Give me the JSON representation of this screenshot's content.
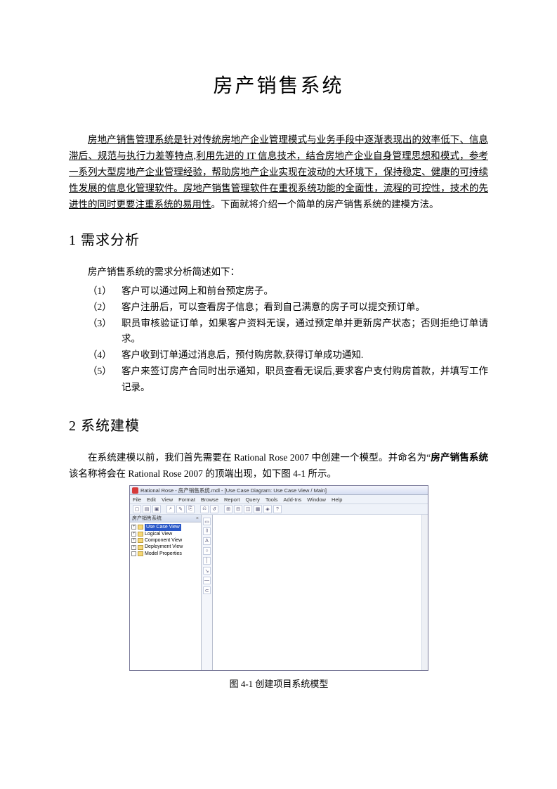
{
  "title": "房产销售系统",
  "intro_underlined": "房地产销售管理系统是针对传统房地产企业管理模式与业务手段中逐渐表现出的效率低下、信息滞后、规范与执行力差等特点,利用先进的 IT 信息技术，结合房地产企业自身管理思想和模式，参考一系列大型房地产企业管理经验，帮助房地产企业实现在波动的大环境下，保持稳定、健康的可持续性发展的信息化管理软件。房地产销售管理软件在重视系统功能的全面性，流程的可控性，技术的先进性的同时更要注重系统的易用性",
  "intro_rest": "。下面就将介绍一个简单的房产销售系统的建模方法。",
  "sec1_heading": "1 需求分析",
  "req_intro": "房产销售系统的需求分析简述如下：",
  "req_items": [
    {
      "num": "（1）",
      "text": "客户可以通过网上和前台预定房子。"
    },
    {
      "num": "（2）",
      "text": "客户注册后，可以查看房子信息；看到自己满意的房子可以提交预订单。"
    },
    {
      "num": "（3）",
      "text": "职员审核验证订单，如果客户资料无误，通过预定单并更新房产状态；否则拒绝订单请求。"
    },
    {
      "num": "（4）",
      "text": "客户收到订单通过消息后，预付购房款,获得订单成功通知."
    },
    {
      "num": "（5）",
      "text": "客户来签订房产合同时出示通知，职员查看无误后,要求客户支付购房首款，并填写工作记录。"
    }
  ],
  "sec2_heading": "2 系统建模",
  "build_intro_a": "在系统建模以前，我们首先需要在 Rational Rose 2007 中创建一个模型。并命名为“",
  "build_intro_bold": "房产销售系统",
  "build_intro_b": "  该名称将会在 Rational Rose 2007 的顶端出现，如下图 4-1 所示。",
  "figure_caption": "图 4-1 创建项目系统模型",
  "rr": {
    "title": "Rational Rose - 房产销售系统.mdl - [Use Case Diagram: Use Case View / Main]",
    "menu": [
      "File",
      "Edit",
      "View",
      "Format",
      "Browse",
      "Report",
      "Query",
      "Tools",
      "Add-Ins",
      "Window",
      "Help"
    ],
    "tree_header": "房产销售系统",
    "tree": [
      {
        "label": "Use Case View",
        "selected": true
      },
      {
        "label": "Logical View",
        "selected": false
      },
      {
        "label": "Component View",
        "selected": false
      },
      {
        "label": "Deployment View",
        "selected": false
      },
      {
        "label": "Model Properties",
        "selected": false
      }
    ],
    "palette_icons": [
      "▭",
      "⌷",
      "A",
      "○",
      "│",
      "↘",
      "—",
      "⊂"
    ],
    "toolbar_icons": [
      "▢",
      "▤",
      "▣",
      "⌕",
      "✎",
      "⎘",
      "⎌",
      "↺",
      "⊞",
      "⊟",
      "◫",
      "▦",
      "◈",
      "?"
    ]
  }
}
